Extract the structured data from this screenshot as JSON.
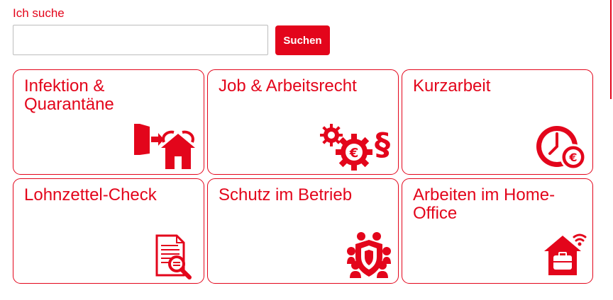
{
  "search": {
    "label": "Ich suche",
    "value": "",
    "placeholder": "",
    "button_label": "Suchen"
  },
  "colors": {
    "accent": "#e3051b",
    "border_input": "#bdbdbd",
    "background": "#ffffff"
  },
  "tiles": [
    {
      "title": "Infektion & Quarantäne",
      "icon": "door-exit-home-icon"
    },
    {
      "title": "Job & Arbeitsrecht",
      "icon": "gears-euro-paragraph-icon"
    },
    {
      "title": "Kurzarbeit",
      "icon": "clock-euro-icon"
    },
    {
      "title": "Lohnzettel-Check",
      "icon": "document-magnifier-icon"
    },
    {
      "title": "Schutz im Betrieb",
      "icon": "group-shield-icon"
    },
    {
      "title": "Arbeiten im Home-Office",
      "icon": "home-office-briefcase-icon"
    }
  ]
}
